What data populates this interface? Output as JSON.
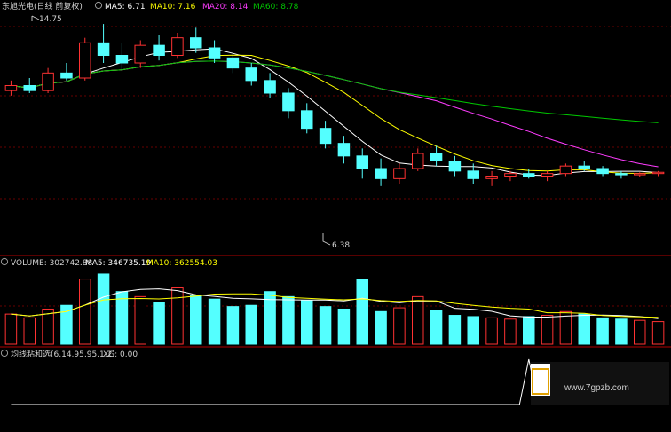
{
  "colors": {
    "up": "#ff3232",
    "down": "#54ffff",
    "ma5": "#ffffff",
    "ma10": "#ffff00",
    "ma20": "#ff3cff",
    "ma60": "#00c800",
    "separator": "#b00000",
    "grid": "#8b0000",
    "text": "#d0d0d0"
  },
  "price_panel": {
    "title": "东旭光电(日线 前复权)",
    "ma5_label": "MA5: 6.71",
    "ma10_label": "MA10: 7.16",
    "ma20_label": "MA20: 8.14",
    "ma60_label": "MA60: 8.78",
    "high_label": "14.75",
    "low_label": "6.38"
  },
  "volume_panel": {
    "volume_label": "VOLUME: 302742.88",
    "ma5_label": "MA5: 346735.19",
    "ma10_label": "MA10: 362554.03"
  },
  "indicator_panel": {
    "title": "均线粘和选(6,14,95,95,1,2)",
    "xg_label": "XG: 0.00"
  },
  "watermark": {
    "text": "www.7gpzb.com"
  },
  "chart_data": {
    "type": "candlestick",
    "series": [
      {
        "name": "price",
        "ohlc": [
          [
            12.1,
            12.5,
            11.9,
            12.3
          ],
          [
            12.3,
            12.6,
            12.0,
            12.1
          ],
          [
            12.1,
            13.0,
            12.0,
            12.8
          ],
          [
            12.8,
            13.2,
            12.5,
            12.6
          ],
          [
            12.6,
            14.2,
            12.5,
            14.0
          ],
          [
            14.0,
            14.75,
            13.2,
            13.5
          ],
          [
            13.5,
            14.0,
            12.9,
            13.2
          ],
          [
            13.2,
            14.1,
            13.0,
            13.9
          ],
          [
            13.9,
            14.3,
            13.3,
            13.5
          ],
          [
            13.5,
            14.4,
            13.4,
            14.2
          ],
          [
            14.2,
            14.6,
            13.6,
            13.8
          ],
          [
            13.8,
            14.1,
            13.2,
            13.4
          ],
          [
            13.4,
            13.6,
            12.8,
            13.0
          ],
          [
            13.0,
            13.2,
            12.3,
            12.5
          ],
          [
            12.5,
            12.8,
            11.8,
            12.0
          ],
          [
            12.0,
            12.2,
            11.0,
            11.3
          ],
          [
            11.3,
            11.6,
            10.4,
            10.6
          ],
          [
            10.6,
            10.9,
            9.8,
            10.0
          ],
          [
            10.0,
            10.3,
            9.2,
            9.5
          ],
          [
            9.5,
            9.8,
            8.6,
            9.0
          ],
          [
            9.0,
            9.4,
            8.3,
            8.6
          ],
          [
            8.6,
            9.2,
            8.4,
            9.0
          ],
          [
            9.0,
            9.8,
            8.9,
            9.6
          ],
          [
            9.6,
            9.9,
            9.1,
            9.3
          ],
          [
            9.3,
            9.5,
            8.7,
            8.9
          ],
          [
            8.9,
            9.2,
            8.4,
            8.6
          ],
          [
            8.6,
            8.9,
            8.3,
            8.7
          ],
          [
            8.7,
            8.9,
            8.5,
            8.8
          ],
          [
            8.8,
            9.0,
            8.6,
            8.7
          ],
          [
            8.7,
            8.9,
            8.5,
            8.8
          ],
          [
            8.8,
            9.2,
            8.7,
            9.1
          ],
          [
            9.1,
            9.3,
            8.9,
            9.0
          ],
          [
            9.0,
            9.1,
            8.7,
            8.8
          ],
          [
            8.8,
            8.9,
            8.6,
            8.75
          ],
          [
            8.75,
            8.85,
            8.65,
            8.8
          ],
          [
            8.8,
            8.9,
            8.7,
            8.85
          ]
        ]
      }
    ],
    "ylim": [
      6.0,
      15.0
    ],
    "volume": [
      [
        240,
        1
      ],
      [
        210,
        1
      ],
      [
        280,
        1
      ],
      [
        310,
        0
      ],
      [
        520,
        1
      ],
      [
        560,
        0
      ],
      [
        420,
        0
      ],
      [
        380,
        1
      ],
      [
        330,
        0
      ],
      [
        450,
        1
      ],
      [
        390,
        0
      ],
      [
        360,
        0
      ],
      [
        300,
        0
      ],
      [
        310,
        0
      ],
      [
        420,
        0
      ],
      [
        380,
        0
      ],
      [
        350,
        0
      ],
      [
        300,
        0
      ],
      [
        280,
        0
      ],
      [
        520,
        0
      ],
      [
        260,
        0
      ],
      [
        290,
        1
      ],
      [
        380,
        1
      ],
      [
        270,
        0
      ],
      [
        230,
        0
      ],
      [
        220,
        0
      ],
      [
        210,
        1
      ],
      [
        200,
        1
      ],
      [
        220,
        0
      ],
      [
        230,
        1
      ],
      [
        260,
        1
      ],
      [
        240,
        0
      ],
      [
        210,
        0
      ],
      [
        200,
        0
      ],
      [
        190,
        1
      ],
      [
        180,
        1
      ]
    ],
    "xg_signal": [
      0,
      0,
      0,
      0,
      0,
      0,
      0,
      0,
      0,
      0,
      0,
      0,
      0,
      0,
      0,
      0,
      0,
      0,
      0,
      0,
      0,
      0,
      0,
      0,
      0,
      0,
      0,
      0,
      1,
      0,
      0,
      0,
      0,
      0,
      0,
      0
    ]
  }
}
